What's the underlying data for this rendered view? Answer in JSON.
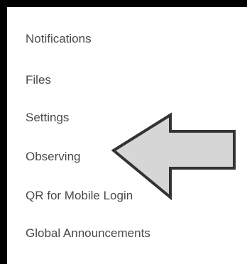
{
  "menu": {
    "items": [
      {
        "id": "notifications",
        "label": "Notifications"
      },
      {
        "id": "files",
        "label": "Files"
      },
      {
        "id": "settings",
        "label": "Settings"
      },
      {
        "id": "observing",
        "label": "Observing"
      },
      {
        "id": "qr-mobile-login",
        "label": "QR for Mobile Login"
      },
      {
        "id": "global-announcements",
        "label": "Global Announcements"
      }
    ]
  },
  "annotation": {
    "icon": "left-arrow-icon",
    "fill_color": "#d6d6d6",
    "stroke_color": "#333333"
  },
  "colors": {
    "frame": "#000000",
    "panel": "#ffffff",
    "text": "#4a4a4a"
  }
}
